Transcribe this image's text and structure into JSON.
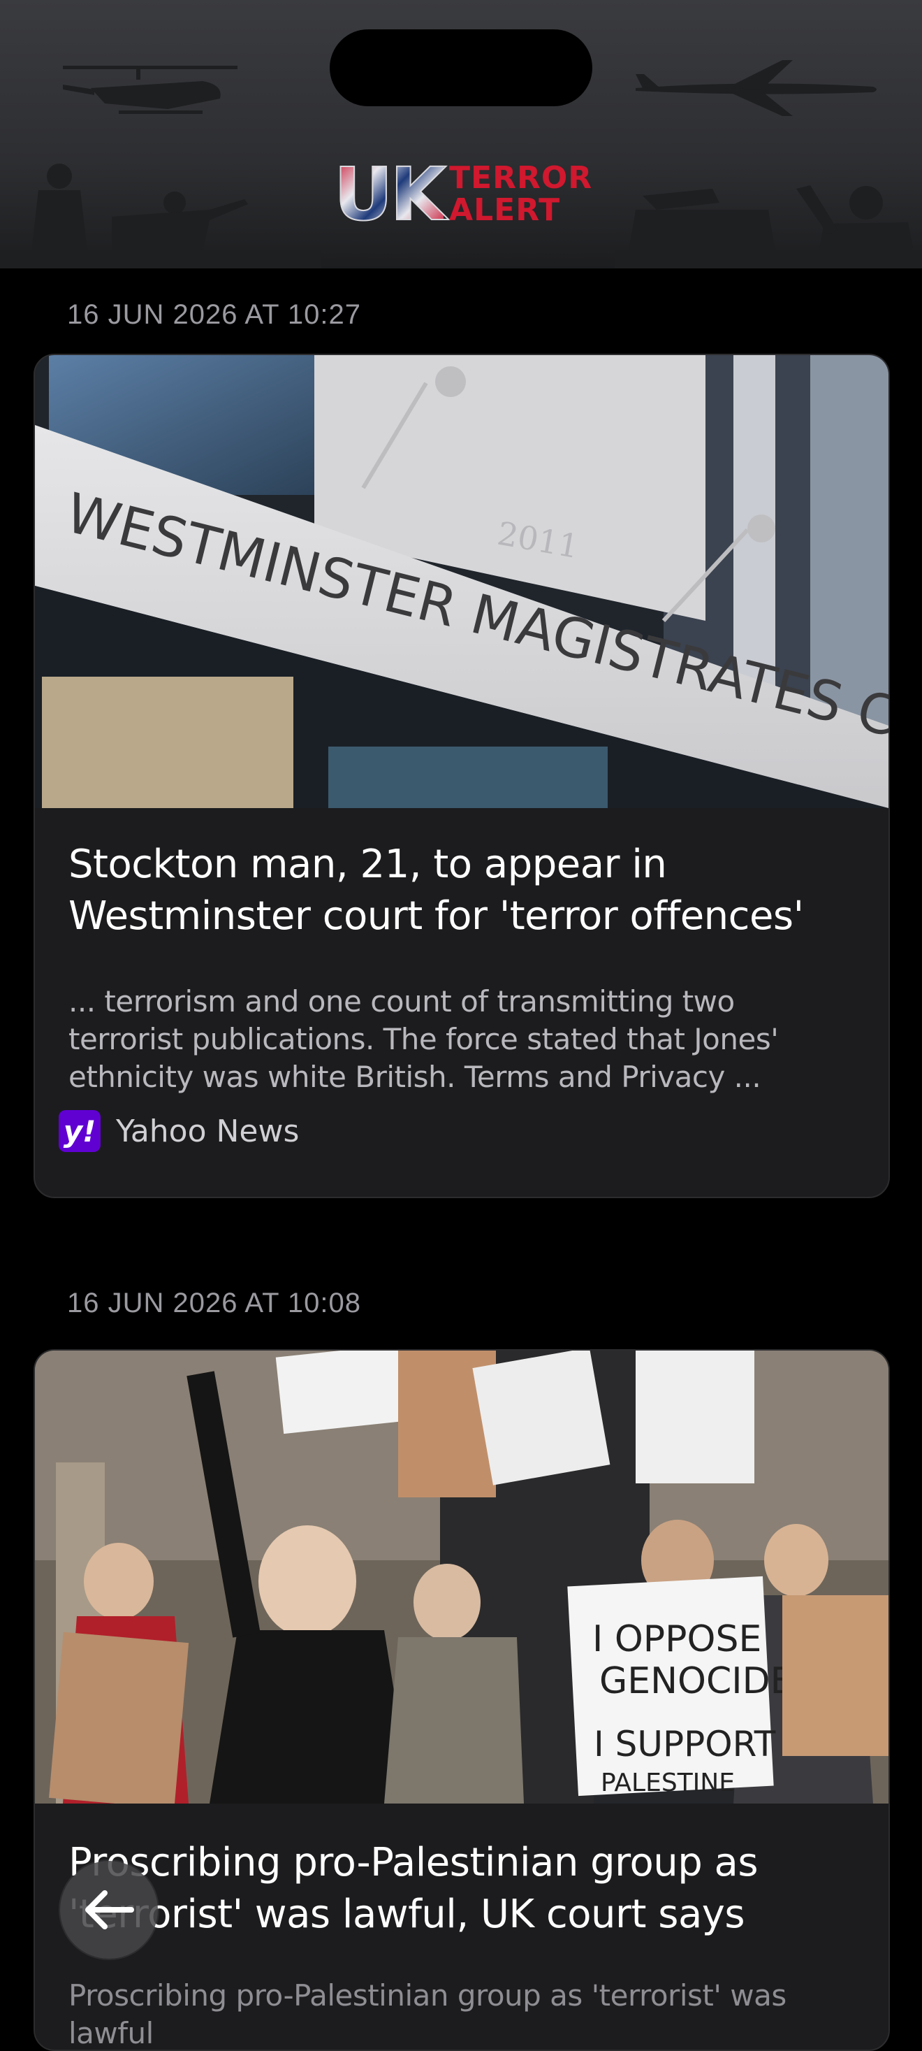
{
  "header": {
    "logo_uk": "UK",
    "logo_terror": "TERROR",
    "logo_alert": "ALERT"
  },
  "articles": [
    {
      "timestamp": "16 JUN 2026 AT 10:27",
      "image_alt": "Westminster Magistrates Court building",
      "sign_text": "WESTMINSTER MAGISTRATES COURT",
      "title": "Stockton man, 21, to appear in Westminster court for 'terror offences'",
      "snippet": "... terrorism and one count of transmitting two terrorist publications. The force stated that Jones' ethnicity was white British. Terms and Privacy ...",
      "source": "Yahoo News",
      "source_icon": "yahoo-logo"
    },
    {
      "timestamp": "16 JUN 2026 AT 10:08",
      "image_alt": "Protesters holding signs outside court",
      "sign_1": "I OPPOSE GENOCIDE",
      "sign_2": "I SUPPORT PALESTINE",
      "title": "Proscribing pro-Palestinian group as 'terrorist' was lawful, UK court says",
      "snippet": "Proscribing pro-Palestinian group as 'terrorist' was lawful"
    }
  ],
  "back_button": {
    "icon": "arrow-left-icon"
  },
  "colors": {
    "background": "#000000",
    "card": "#1c1c1e",
    "accent_red": "#d0182e",
    "yahoo_purple": "#6001d2"
  }
}
